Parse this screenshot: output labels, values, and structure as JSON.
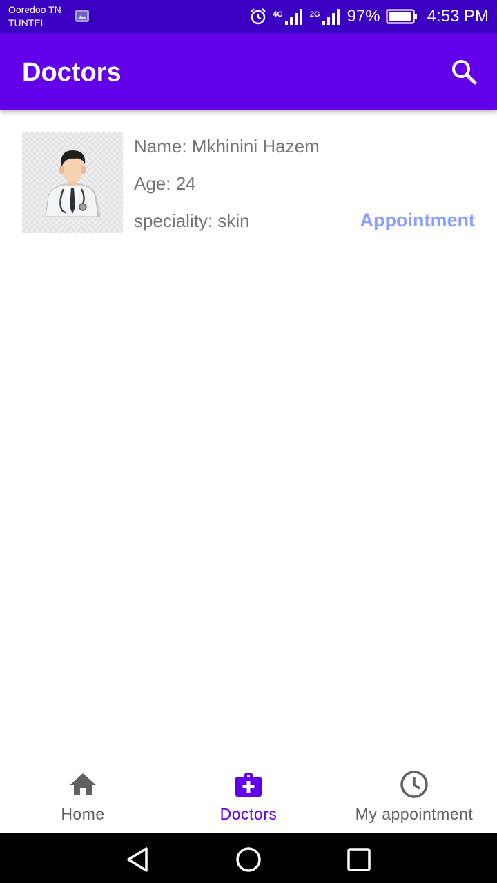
{
  "status_bar": {
    "carrier_1": "Ooredoo TN",
    "carrier_2": "TUNTEL",
    "net_1": "4G",
    "net_2": "2G",
    "battery_percent": "97%",
    "time": "4:53 PM",
    "icons": [
      "gallery-icon",
      "alarm-icon",
      "signal-icon",
      "battery-icon"
    ]
  },
  "app_bar": {
    "title": "Doctors",
    "search_icon": "search-icon"
  },
  "doctors": [
    {
      "name_line": "Name: Mkhinini Hazem",
      "age_line": "Age: 24",
      "speciality_line": "speciality: skin",
      "action_label": "Appointment"
    }
  ],
  "bottom_nav": {
    "items": [
      {
        "label": "Home",
        "icon": "home-icon",
        "active": false
      },
      {
        "label": "Doctors",
        "icon": "medical-kit-icon",
        "active": true
      },
      {
        "label": "My appointment",
        "icon": "clock-icon",
        "active": false
      }
    ]
  },
  "system_nav": [
    "back-icon",
    "home-circle-icon",
    "recents-icon"
  ],
  "colors": {
    "status_bar": "#3a00c2",
    "app_bar": "#6200ea",
    "accent_link": "#8c9eff",
    "text_secondary": "#757575",
    "nav_inactive": "#616161"
  }
}
